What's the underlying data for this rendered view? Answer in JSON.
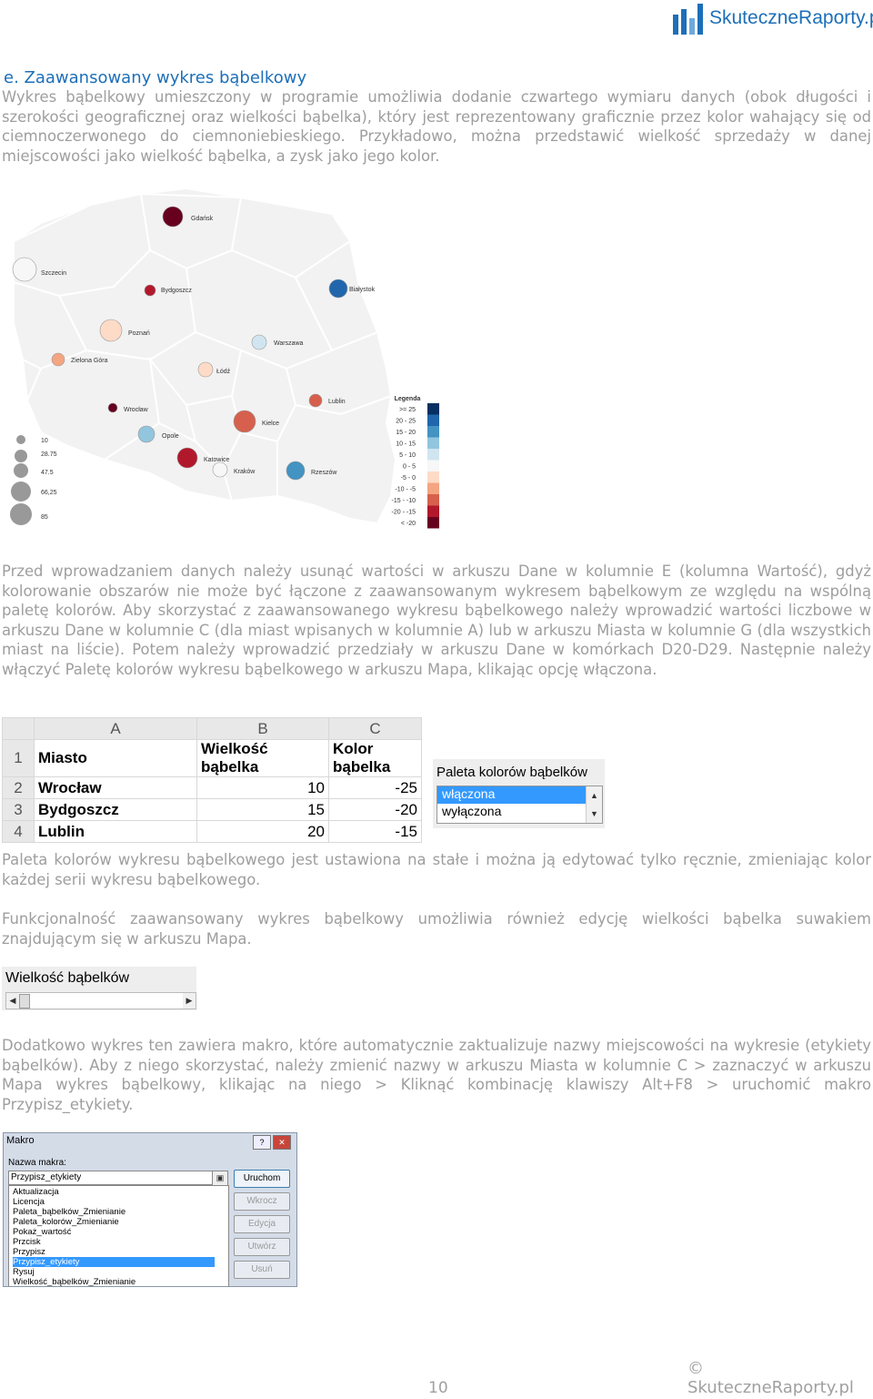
{
  "header": {
    "logo_text": "SkuteczneRaporty.pl"
  },
  "section": {
    "title": "e. Zaawansowany wykres bąbelkowy",
    "p1": "Wykres bąbelkowy umieszczony w programie umożliwia dodanie czwartego wymiaru danych (obok długości i szerokości geograficznej oraz wielkości bąbelka), który jest reprezentowany graficznie przez kolor wahający się od ciemnoczerwonego do ciemnoniebieskiego. Przykładowo, można przedstawić wielkość sprzedaży w danej miejscowości jako wielkość bąbelka, a zysk jako jego kolor.",
    "p2": "Przed wprowadzaniem danych należy usunąć wartości w arkuszu Dane w kolumnie E (kolumna Wartość), gdyż kolorowanie obszarów nie może być łączone z zaawansowanym wykresem bąbelkowym ze względu na wspólną paletę kolorów. Aby skorzystać z zaawansowanego wykresu bąbelkowego należy wprowadzić wartości liczbowe w arkuszu Dane w kolumnie C (dla miast wpisanych w kolumnie A) lub w arkuszu Miasta w kolumnie G (dla wszystkich miast na liście). Potem należy wprowadzić przedziały w arkuszu Dane w komórkach D20-D29. Następnie należy włączyć Paletę kolorów wykresu bąbelkowego w arkuszu Mapa, klikając opcję włączona.",
    "p3": "Paleta kolorów wykresu bąbelkowego jest ustawiona na stałe i można ją edytować tylko ręcznie, zmieniając kolor każdej serii wykresu bąbelkowego.",
    "p4": "Funkcjonalność zaawansowany wykres bąbelkowy umożliwia również edycję wielkości bąbelka suwakiem znajdującym się w arkuszu Mapa.",
    "p5": "Dodatkowo wykres ten zawiera makro, które automatycznie zaktualizuje nazwy miejscowości na wykresie (etykiety bąbelków). Aby z niego skorzystać, należy zmienić nazwy w arkuszu Miasta w kolumnie C > zaznaczyć w arkuszu Mapa wykres bąbelkowy, klikając na niego > Kliknąć kombinację klawiszy Alt+F8 > uruchomić makro Przypisz_etykiety."
  },
  "map": {
    "cities": [
      {
        "name": "Gdańsk",
        "color": "#67001f"
      },
      {
        "name": "Szczecin",
        "color": "#f7f7f7"
      },
      {
        "name": "Bydgoszcz",
        "color": "#b2182b"
      },
      {
        "name": "Białystok",
        "color": "#2166ac"
      },
      {
        "name": "Poznań",
        "color": "#fddbc7"
      },
      {
        "name": "Warszawa",
        "color": "#d1e5f0"
      },
      {
        "name": "Zielona Góra",
        "color": "#f4a582"
      },
      {
        "name": "Łódź",
        "color": "#fddbc7"
      },
      {
        "name": "Lublin",
        "color": "#d6604d"
      },
      {
        "name": "Wrocław",
        "color": "#67001f"
      },
      {
        "name": "Kielce",
        "color": "#d6604d"
      },
      {
        "name": "Opole",
        "color": "#92c5de"
      },
      {
        "name": "Katowice",
        "color": "#b2182b"
      },
      {
        "name": "Kraków",
        "color": "#f7f7f7"
      },
      {
        "name": "Rzeszów",
        "color": "#4393c3"
      }
    ],
    "size_legend": [
      "10",
      "28.75",
      "47.5",
      "66,25",
      "85"
    ],
    "legend_title": "Legenda",
    "legend": [
      {
        "label": ">=   25",
        "color": "#053061"
      },
      {
        "label": "20  -  25",
        "color": "#2166ac"
      },
      {
        "label": "15  -  20",
        "color": "#4393c3"
      },
      {
        "label": "10  -  15",
        "color": "#92c5de"
      },
      {
        "label": "5  -  10",
        "color": "#d1e5f0"
      },
      {
        "label": "0  -  5",
        "color": "#f7f7f7"
      },
      {
        "label": "-5  -  0",
        "color": "#fddbc7"
      },
      {
        "label": "-10  -  -5",
        "color": "#f4a582"
      },
      {
        "label": "-15  -  -10",
        "color": "#d6604d"
      },
      {
        "label": "-20  -  -15",
        "color": "#b2182b"
      },
      {
        "label": "<   -20",
        "color": "#67001f"
      }
    ]
  },
  "sheet": {
    "columns": [
      "A",
      "B",
      "C"
    ],
    "row_numbers": [
      "1",
      "2",
      "3",
      "4"
    ],
    "header": [
      "Miasto",
      "Wielkość bąbelka",
      "Kolor bąbelka"
    ],
    "rows": [
      [
        "Wrocław",
        "10",
        "-25"
      ],
      [
        "Bydgoszcz",
        "15",
        "-20"
      ],
      [
        "Lublin",
        "20",
        "-15"
      ]
    ]
  },
  "palette": {
    "title": "Paleta kolorów bąbelków",
    "options": [
      "włączona",
      "wyłączona"
    ],
    "selected": "włączona"
  },
  "slider": {
    "title": "Wielkość bąbelków"
  },
  "dialog": {
    "title": "Makro",
    "label": "Nazwa makra:",
    "input_value": "Przypisz_etykiety",
    "items": [
      "Aktualizacja",
      "Licencja",
      "Paleta_bąbelków_Zmienianie",
      "Paleta_kolorów_Zmienianie",
      "Pokaż_wartość",
      "Przcisk",
      "Przypisz",
      "Przypisz_etykiety",
      "Rysuj",
      "Wielkość_bąbelków_Zmienianie"
    ],
    "selected_item": "Przypisz_etykiety",
    "buttons": [
      "Uruchom",
      "Wkrocz",
      "Edycja",
      "Utwórz",
      "Usuń"
    ]
  },
  "footer": {
    "copyright": "© SkuteczneRaporty.pl",
    "page": "10"
  }
}
